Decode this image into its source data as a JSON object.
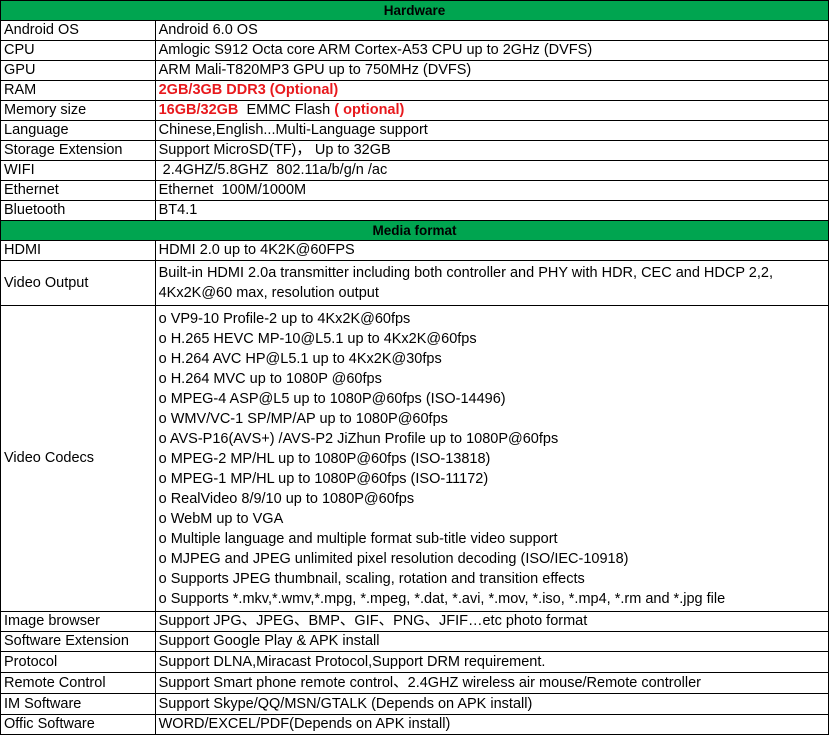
{
  "sections": {
    "hardware": "Hardware",
    "media": "Media format"
  },
  "hardware": {
    "android_os": {
      "label": "Android OS",
      "value": "Android 6.0 OS"
    },
    "cpu": {
      "label": "CPU",
      "value": "Amlogic S912 Octa core ARM Cortex-A53 CPU up to 2GHz (DVFS)"
    },
    "gpu": {
      "label": "GPU",
      "value": "ARM Mali-T820MP3 GPU up to 750MHz (DVFS)"
    },
    "ram": {
      "label": "RAM",
      "value": "2GB/3GB DDR3 (Optional)"
    },
    "memory": {
      "label": "Memory size",
      "value_red1": "16GB/32GB",
      "value_plain": "  EMMC Flash ",
      "value_red2": "( optional)"
    },
    "language": {
      "label": "Language",
      "value": "Chinese,English...Multi-Language support"
    },
    "storage": {
      "label": "Storage Extension",
      "value": "Support MicroSD(TF)， Up to 32GB"
    },
    "wifi": {
      "label": "WIFI",
      "value": " 2.4GHZ/5.8GHZ  802.11a/b/g/n /ac"
    },
    "ethernet": {
      "label": "Ethernet",
      "value": "Ethernet  100M/1000M"
    },
    "bluetooth": {
      "label": "Bluetooth",
      "value": "BT4.1"
    }
  },
  "media": {
    "hdmi": {
      "label": "HDMI",
      "value": "HDMI 2.0 up to 4K2K@60FPS"
    },
    "video_output": {
      "label": "Video Output",
      "value": "Built-in HDMI 2.0a transmitter including both controller and PHY with HDR, CEC and HDCP 2,2, 4Kx2K@60 max, resolution output"
    },
    "video_codecs": {
      "label": "Video Codecs",
      "items": [
        "o  VP9-10 Profile-2 up to 4Kx2K@60fps",
        "o  H.265 HEVC MP-10@L5.1 up to 4Kx2K@60fps",
        "o  H.264 AVC HP@L5.1 up to 4Kx2K@30fps",
        "o  H.264 MVC up to 1080P @60fps",
        "o  MPEG-4 ASP@L5 up to 1080P@60fps (ISO-14496)",
        "o  WMV/VC-1 SP/MP/AP up to 1080P@60fps",
        "o  AVS-P16(AVS+) /AVS-P2 JiZhun Profile up to 1080P@60fps",
        "o  MPEG-2 MP/HL up to 1080P@60fps (ISO-13818)",
        "o  MPEG-1 MP/HL up to 1080P@60fps (ISO-11172)",
        "o  RealVideo 8/9/10 up to 1080P@60fps",
        "o  WebM up to VGA",
        "o  Multiple language and multiple format sub-title video support",
        "o  MJPEG and JPEG unlimited pixel resolution decoding (ISO/IEC-10918)",
        "o  Supports JPEG thumbnail, scaling, rotation and transition effects",
        "o  Supports *.mkv,*.wmv,*.mpg, *.mpeg, *.dat, *.avi, *.mov, *.iso, *.mp4, *.rm and *.jpg file"
      ]
    },
    "image_browser": {
      "label": "Image browser",
      "value": "Support JPG、JPEG、BMP、GIF、PNG、JFIF…etc photo format"
    },
    "software_ext": {
      "label": "Software Extension",
      "value": "Support Google Play & APK install"
    },
    "protocol": {
      "label": "Protocol",
      "value": "Support DLNA,Miracast Protocol,Support DRM requirement."
    },
    "remote": {
      "label": "Remote Control",
      "value": "Support Smart phone remote control、2.4GHZ wireless air mouse/Remote controller"
    },
    "im": {
      "label": "IM Software",
      "value": "Support Skype/QQ/MSN/GTALK (Depends on APK install)"
    },
    "office": {
      "label": "Offic Software",
      "value": "WORD/EXCEL/PDF(Depends on APK install)"
    }
  },
  "colors": {
    "section_bg": "#00a550",
    "highlight_red": "#e8191d",
    "border": "#000000"
  }
}
